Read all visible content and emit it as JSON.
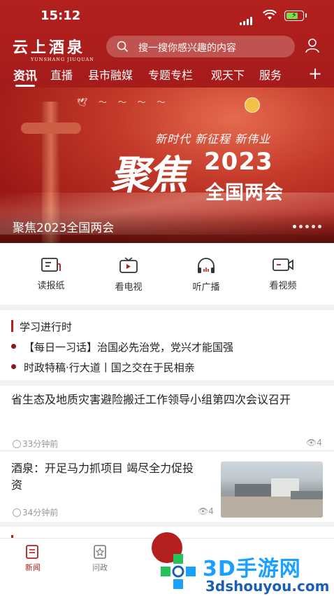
{
  "status_bar": {
    "time": "15:12"
  },
  "header": {
    "logo_cn": "云上酒泉",
    "logo_en": "YUNSHANG JIUQUAN",
    "search_placeholder": "搜一搜你感兴趣的内容",
    "user_icon": "user-icon",
    "search_icon": "search-icon"
  },
  "tabs": [
    {
      "label": "资讯",
      "active": true
    },
    {
      "label": "直播"
    },
    {
      "label": "县市融媒"
    },
    {
      "label": "专题专栏"
    },
    {
      "label": "观天下"
    },
    {
      "label": "服务"
    }
  ],
  "tabs_plus": "+",
  "banner": {
    "slogan": "新时代 新征程 新伟业",
    "big_text": "聚焦",
    "year": "2023",
    "meeting": "全国两会",
    "caption": "聚焦2023全国两会",
    "slide_count": 5,
    "active_slide": 1
  },
  "quick_links": [
    {
      "label": "读报纸",
      "icon": "newspaper-icon"
    },
    {
      "label": "看电视",
      "icon": "tv-icon"
    },
    {
      "label": "听广播",
      "icon": "headphones-icon"
    },
    {
      "label": "看视频",
      "icon": "video-camera-icon"
    }
  ],
  "study": {
    "title": "学习进行时",
    "items": [
      "【每日一习话】治国必先治党，党兴才能国强",
      "时政特稿·行大道丨国之交在于民相亲"
    ]
  },
  "news": [
    {
      "title": "省生态及地质灾害避险搬迁工作领导小组第四次会议召开",
      "time": "33分钟前",
      "views": "4"
    },
    {
      "title": "酒泉：开足马力抓项目 竭尽全力促投资",
      "time": "34分钟前",
      "views": "4"
    }
  ],
  "bottom_tabs": [
    {
      "label": "新闻",
      "active": true,
      "icon": "news-icon"
    },
    {
      "label": "问政",
      "icon": "inquiry-icon"
    }
  ],
  "watermark": {
    "brand": "3D手游网",
    "url": "3dshouyou.com"
  },
  "colors": {
    "brand_red": "#b3201e",
    "watermark_blue": "#1aa0ff",
    "watermark_green": "#25c25a"
  }
}
